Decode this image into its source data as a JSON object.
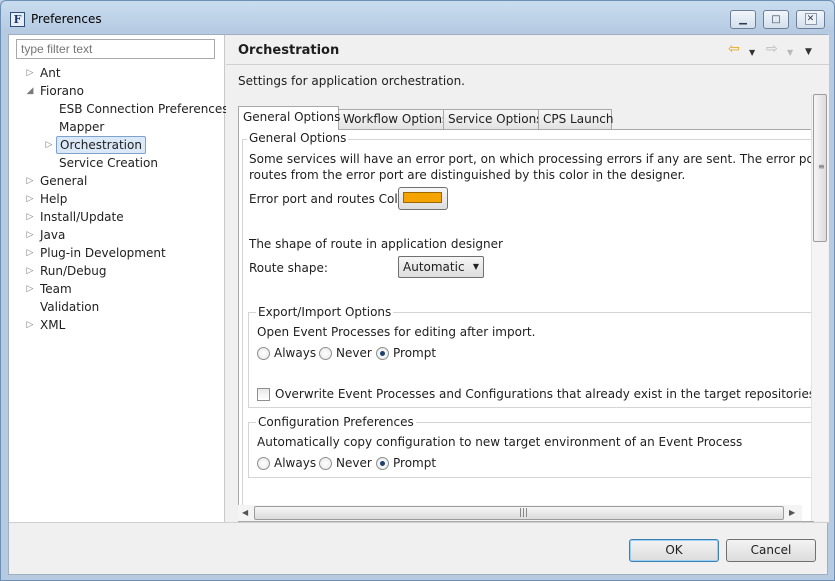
{
  "window": {
    "title": "Preferences",
    "app_icon_letter": "F",
    "minimize_glyph": "▁",
    "maximize_glyph": "□",
    "close_glyph": "✕"
  },
  "filter": {
    "placeholder": "type filter text"
  },
  "tree": [
    {
      "label": "Ant",
      "arrow": "▷",
      "level": 0
    },
    {
      "label": "Fiorano",
      "arrow": "◢",
      "level": 0
    },
    {
      "label": "ESB Connection Preferences",
      "arrow": "",
      "level": 1
    },
    {
      "label": "Mapper",
      "arrow": "",
      "level": 1
    },
    {
      "label": "Orchestration",
      "arrow": "▷",
      "level": 1,
      "selected": true
    },
    {
      "label": "Service Creation",
      "arrow": "",
      "level": 1
    },
    {
      "label": "General",
      "arrow": "▷",
      "level": 0
    },
    {
      "label": "Help",
      "arrow": "▷",
      "level": 0
    },
    {
      "label": "Install/Update",
      "arrow": "▷",
      "level": 0
    },
    {
      "label": "Java",
      "arrow": "▷",
      "level": 0
    },
    {
      "label": "Plug-in Development",
      "arrow": "▷",
      "level": 0
    },
    {
      "label": "Run/Debug",
      "arrow": "▷",
      "level": 0
    },
    {
      "label": "Team",
      "arrow": "▷",
      "level": 0
    },
    {
      "label": "Validation",
      "arrow": "",
      "level": 0
    },
    {
      "label": "XML",
      "arrow": "▷",
      "level": 0
    }
  ],
  "page": {
    "title": "Orchestration",
    "description": "Settings for application orchestration.",
    "nav": {
      "back": "⇦",
      "forward": "⇨",
      "dropdown": "▼",
      "menu": "▼"
    }
  },
  "tabs": [
    {
      "label": "General Options",
      "active": true
    },
    {
      "label": "Workflow Options",
      "active": false
    },
    {
      "label": "Service Options",
      "active": false
    },
    {
      "label": "CPS Launch",
      "active": false
    }
  ],
  "general": {
    "legend": "General Options",
    "error_desc_line1": "Some services will have an error port, on which processing errors if any are sent. The error port and the",
    "error_desc_line2": "routes from the error port are distinguished by this color in the designer.",
    "error_color_label": "Error port and routes Color:",
    "error_color": "#f5a300",
    "route_shape_desc": "The shape of route in application designer",
    "route_shape_label": "Route shape:",
    "route_shape_value": "Automatic"
  },
  "export_import": {
    "legend": "Export/Import Options",
    "question": "Open Event Processes for editing after import.",
    "options": [
      "Always",
      "Never",
      "Prompt"
    ],
    "selected": "Prompt",
    "overwrite_label": "Overwrite Event Processes and Configurations that already exist in the target repositories.",
    "overwrite_checked": false
  },
  "config_prefs": {
    "legend": "Configuration Preferences",
    "question": "Automatically copy configuration to new target environment of an Event Process",
    "options": [
      "Always",
      "Never",
      "Prompt"
    ],
    "selected": "Prompt"
  },
  "scroll": {
    "left_arrow": "◀",
    "right_arrow": "▶",
    "h_grip": "|||",
    "v_grip": "≡",
    "dropdown_arrow": "▼"
  },
  "buttons": {
    "ok": "OK",
    "cancel": "Cancel"
  }
}
